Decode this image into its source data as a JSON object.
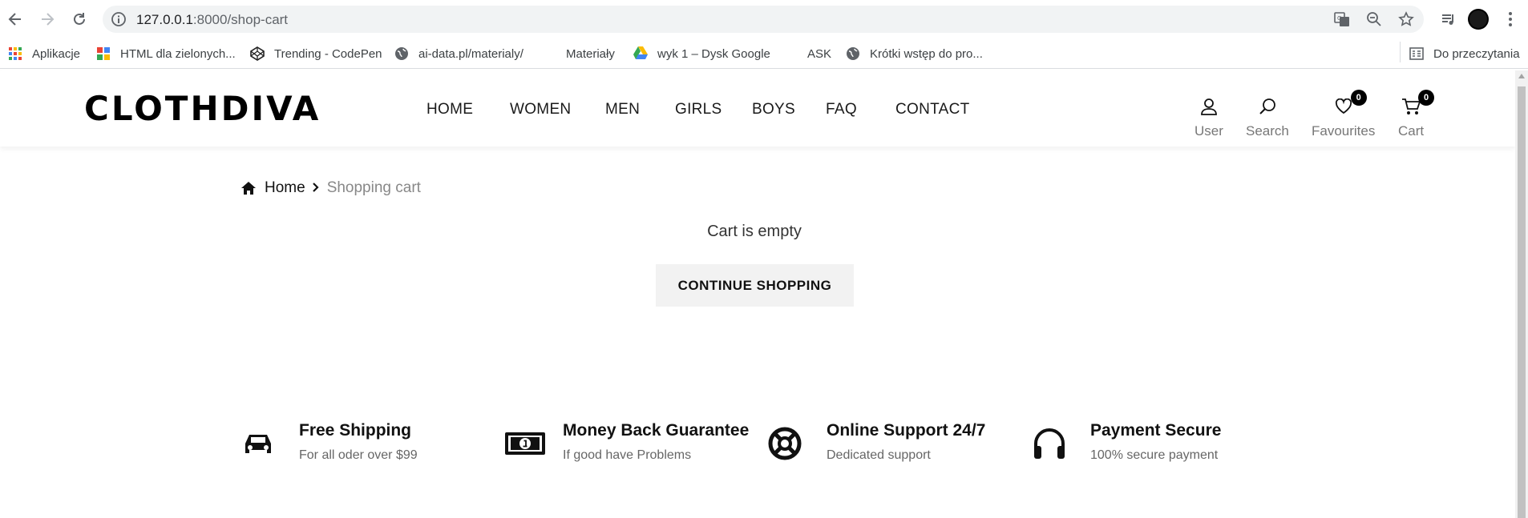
{
  "browser": {
    "url_host": "127.0.0.1",
    "url_path": ":8000/shop-cart",
    "bookmarks": [
      {
        "label": "Aplikacje",
        "icon": "apps-grid-icon"
      },
      {
        "label": "HTML dla zielonych...",
        "icon": "colorful-site-icon"
      },
      {
        "label": "Trending - CodePen",
        "icon": "codepen-icon"
      },
      {
        "label": "ai-data.pl/materialy/",
        "icon": "globe-icon"
      },
      {
        "label": "Materiały",
        "icon": "blank-icon"
      },
      {
        "label": "wyk 1 – Dysk Google",
        "icon": "google-drive-icon"
      },
      {
        "label": "ASK",
        "icon": "blank-icon"
      },
      {
        "label": "Krótki wstęp do pro...",
        "icon": "globe-icon"
      }
    ],
    "reading_list": "Do przeczytania"
  },
  "header": {
    "logo": "CLOTHDIVA",
    "menu": [
      "HOME",
      "WOMEN",
      "MEN",
      "GIRLS",
      "BOYS",
      "FAQ",
      "CONTACT"
    ],
    "user_label": "User",
    "search_label": "Search",
    "favourites_label": "Favourites",
    "favourites_count": "0",
    "cart_label": "Cart",
    "cart_count": "0"
  },
  "breadcrumb": {
    "home": "Home",
    "current": "Shopping cart"
  },
  "cart": {
    "empty_message": "Cart is empty",
    "continue_label": "CONTINUE SHOPPING"
  },
  "features": [
    {
      "title": "Free Shipping",
      "subtitle": "For all oder over $99",
      "icon": "car-icon"
    },
    {
      "title": "Money Back Guarantee",
      "subtitle": "If good have Problems",
      "icon": "money-icon"
    },
    {
      "title": "Online Support 24/7",
      "subtitle": "Dedicated support",
      "icon": "lifebuoy-icon"
    },
    {
      "title": "Payment Secure",
      "subtitle": "100% secure payment",
      "icon": "headphones-icon"
    }
  ]
}
